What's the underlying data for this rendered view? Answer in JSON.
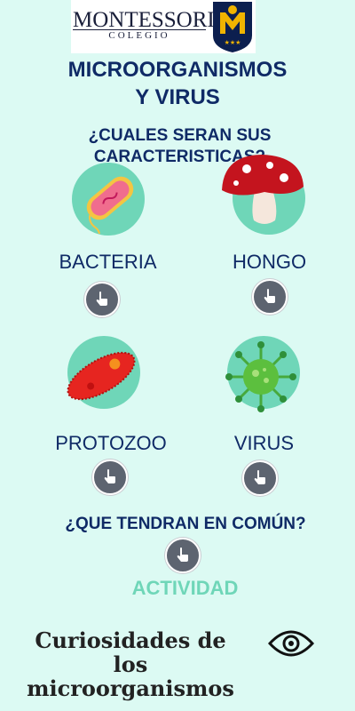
{
  "logo": {
    "name": "MONTESSORI",
    "subtitle": "COLEGIO",
    "shield_letter": "M"
  },
  "header": {
    "title_line1": "MICROORGANISMOS",
    "title_line2": "Y VIRUS"
  },
  "question": {
    "line1": "¿CUALES SERAN SUS",
    "line2": "CARACTERISTICAS?"
  },
  "cards": [
    {
      "label": "BACTERIA",
      "icon": "bacteria-icon"
    },
    {
      "label": "HONGO",
      "icon": "mushroom-icon"
    },
    {
      "label": "PROTOZOO",
      "icon": "protozoa-icon"
    },
    {
      "label": "VIRUS",
      "icon": "virus-icon"
    }
  ],
  "common": {
    "question": "¿QUE TENDRAN EN COMÚN?"
  },
  "activity": {
    "label": "ACTIVIDAD"
  },
  "curiosities": {
    "line1": "Curiosidades de los",
    "line2": "microorganismos"
  },
  "colors": {
    "background": "#dcfaf3",
    "navy": "#0f2a66",
    "mint": "#6fd6b8",
    "button": "#5d6470"
  }
}
